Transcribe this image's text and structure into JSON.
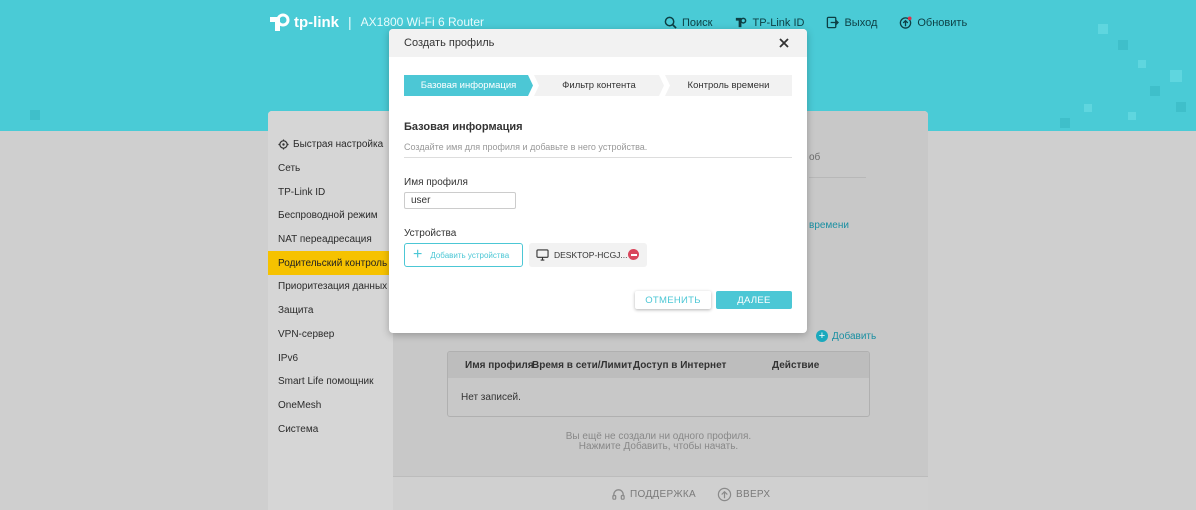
{
  "header": {
    "brand": "tp-link",
    "separator": "|",
    "model": "AX1800 Wi-Fi 6 Router",
    "nav": [
      {
        "label": "Поиск",
        "icon": "search-icon"
      },
      {
        "label": "TP-Link ID",
        "icon": "tplink-id-icon"
      },
      {
        "label": "Выход",
        "icon": "logout-icon"
      },
      {
        "label": "Обновить",
        "icon": "update-icon"
      }
    ]
  },
  "sidebar": {
    "items": [
      {
        "label": "Быстрая настройка",
        "icon": "quick-setup-icon"
      },
      {
        "label": "Сеть"
      },
      {
        "label": "TP-Link ID"
      },
      {
        "label": "Беспроводной режим"
      },
      {
        "label": "NAT переадресация"
      },
      {
        "label": "Родительский контроль",
        "active": true
      },
      {
        "label": "Приоритезация данных"
      },
      {
        "label": "Защита"
      },
      {
        "label": "VPN-сервер"
      },
      {
        "label": "IPv6"
      },
      {
        "label": "Smart Life помощник"
      },
      {
        "label": "OneMesh"
      },
      {
        "label": "Система"
      }
    ]
  },
  "main": {
    "behind_text_1": "об",
    "behind_text_2": "времени",
    "add_label": "Добавить",
    "table": {
      "columns": [
        "Имя профиля",
        "Время в сети/Лимит",
        "Доступ в Интернет",
        "Действие"
      ],
      "empty_row": "Нет записей."
    },
    "empty_message_1": "Вы ещё не создали ни одного профиля.",
    "empty_message_2": "Нажмите Добавить, чтобы начать."
  },
  "footer": {
    "support": "ПОДДЕРЖКА",
    "top": "ВВЕРХ"
  },
  "modal": {
    "title": "Создать профиль",
    "steps": [
      "Базовая информация",
      "Фильтр контента",
      "Контроль времени"
    ],
    "active_step": 0,
    "section_title": "Базовая информация",
    "section_desc": "Создайте имя для профиля и добавьте в него устройства.",
    "profile_name_label": "Имя профиля",
    "profile_name_value": "user",
    "devices_label": "Устройства",
    "add_devices_label": "Добавить устройства",
    "device_name": "DESKTOP-HCGJ...",
    "cancel_label": "ОТМЕНИТЬ",
    "next_label": "ДАЛЕЕ"
  },
  "colors": {
    "accent": "#4cc7d5",
    "header_band": "#4acbd6",
    "active_menu": "#f6c200",
    "remove": "#d9465c"
  }
}
